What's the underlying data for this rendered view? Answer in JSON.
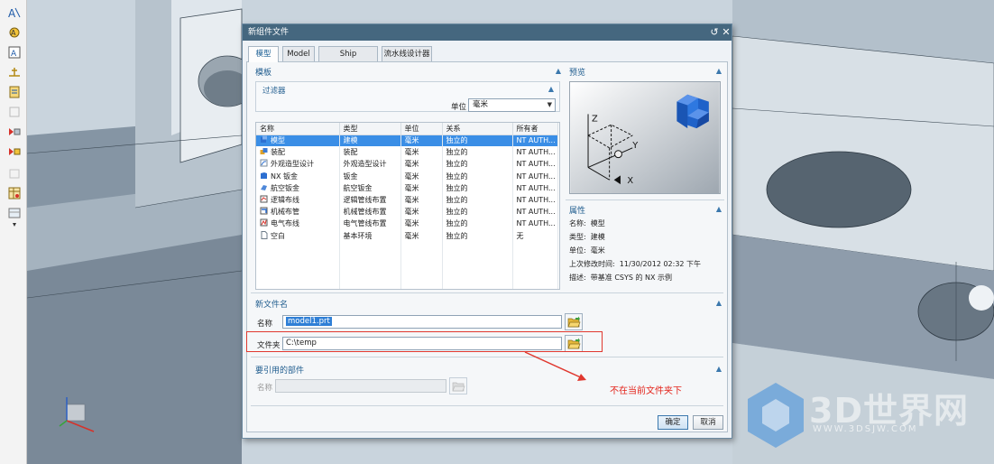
{
  "dialog": {
    "title": "新组件文件",
    "tabs": [
      {
        "label": "模型",
        "active": true
      },
      {
        "label": "Model",
        "active": false
      },
      {
        "label": "Ship Structures",
        "active": false
      },
      {
        "label": "流水线设计器",
        "active": false
      }
    ]
  },
  "templates": {
    "section_title": "模板",
    "filter": {
      "title": "过滤器",
      "unit_label": "单位",
      "unit_value": "毫米"
    },
    "columns": [
      "名称",
      "类型",
      "单位",
      "关系",
      "所有者"
    ],
    "rows": [
      {
        "name": "模型",
        "type": "建模",
        "unit": "毫米",
        "relation": "独立的",
        "owner": "NT AUTH...",
        "icon": "model-icon",
        "selected": true
      },
      {
        "name": "装配",
        "type": "装配",
        "unit": "毫米",
        "relation": "独立的",
        "owner": "NT AUTH...",
        "icon": "assembly-icon",
        "selected": false
      },
      {
        "name": "外观造型设计",
        "type": "外观造型设计",
        "unit": "毫米",
        "relation": "独立的",
        "owner": "NT AUTH...",
        "icon": "shape-design-icon",
        "selected": false
      },
      {
        "name": "NX 钣金",
        "type": "钣金",
        "unit": "毫米",
        "relation": "独立的",
        "owner": "NT AUTH...",
        "icon": "sheet-metal-icon",
        "selected": false
      },
      {
        "name": "航空钣金",
        "type": "航空钣金",
        "unit": "毫米",
        "relation": "独立的",
        "owner": "NT AUTH...",
        "icon": "aero-sheet-metal-icon",
        "selected": false
      },
      {
        "name": "逻辑布线",
        "type": "逻辑管线布置",
        "unit": "毫米",
        "relation": "独立的",
        "owner": "NT AUTH...",
        "icon": "logical-routing-icon",
        "selected": false
      },
      {
        "name": "机械布管",
        "type": "机械管线布置",
        "unit": "毫米",
        "relation": "独立的",
        "owner": "NT AUTH...",
        "icon": "mechanical-routing-icon",
        "selected": false
      },
      {
        "name": "电气布线",
        "type": "电气管线布置",
        "unit": "毫米",
        "relation": "独立的",
        "owner": "NT AUTH...",
        "icon": "electrical-routing-icon",
        "selected": false
      },
      {
        "name": "空白",
        "type": "基本环境",
        "unit": "毫米",
        "relation": "独立的",
        "owner": "无",
        "icon": "blank-icon",
        "selected": false
      }
    ]
  },
  "preview": {
    "title": "预览",
    "axes": {
      "z": "Z",
      "y": "Y",
      "x": "X"
    }
  },
  "properties": {
    "title": "属性",
    "items": [
      {
        "label": "名称:",
        "value": "模型"
      },
      {
        "label": "类型:",
        "value": "建模"
      },
      {
        "label": "单位:",
        "value": "毫米"
      },
      {
        "label": "上次修改时间:",
        "value": "11/30/2012 02:32 下午"
      },
      {
        "label": "描述:",
        "value": "带基准 CSYS 的 NX 示例"
      }
    ]
  },
  "new_file": {
    "title": "新文件名",
    "name_label": "名称",
    "name_value": "model1.prt",
    "folder_label": "文件夹",
    "folder_value": "C:\\temp"
  },
  "referenced": {
    "title": "要引用的部件",
    "name_label": "名称",
    "name_value": ""
  },
  "buttons": {
    "ok": "确定",
    "cancel": "取消"
  },
  "annotation": {
    "text": "不在当前文件夹下",
    "color": "#e3241b"
  },
  "watermark": {
    "main": "3D世界网",
    "url": "WWW.3DSJW.COM"
  },
  "colors": {
    "titlebar": "#45677f",
    "accent": "#1f5c8e",
    "selection": "#3a8ee6"
  }
}
